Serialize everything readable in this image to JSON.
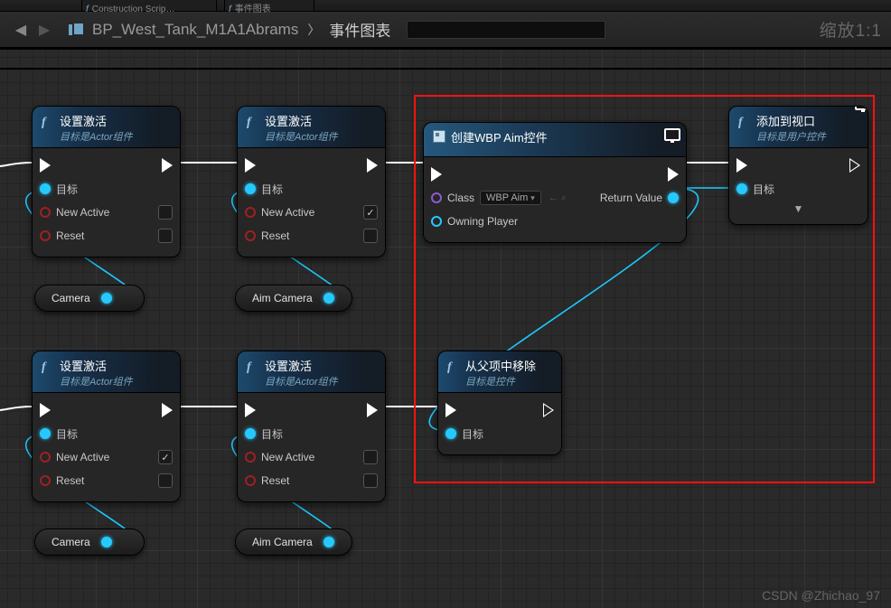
{
  "tabs": {
    "construction": "Construction Scrip…",
    "eventgraph": "事件图表"
  },
  "path": {
    "blueprint": "BP_West_Tank_M1A1Abrams",
    "graph": "事件图表"
  },
  "zoom": "缩放1:1",
  "labels": {
    "target": "目标",
    "newActive": "New Active",
    "reset": "Reset",
    "class": "Class",
    "owningPlayer": "Owning Player",
    "returnValue": "Return Value",
    "classValue": "WBP Aim"
  },
  "nodes": {
    "setActive": {
      "title": "设置激活",
      "sub": "目标是Actor组件"
    },
    "createWidget": {
      "title": "创建WBP Aim控件"
    },
    "addViewport": {
      "title": "添加到视口",
      "sub": "目标是用户控件"
    },
    "removeParent": {
      "title": "从父项中移除",
      "sub": "目标是控件"
    }
  },
  "vars": {
    "camera": "Camera",
    "aimCamera": "Aim Camera"
  },
  "watermark": "CSDN @Zhichao_97"
}
